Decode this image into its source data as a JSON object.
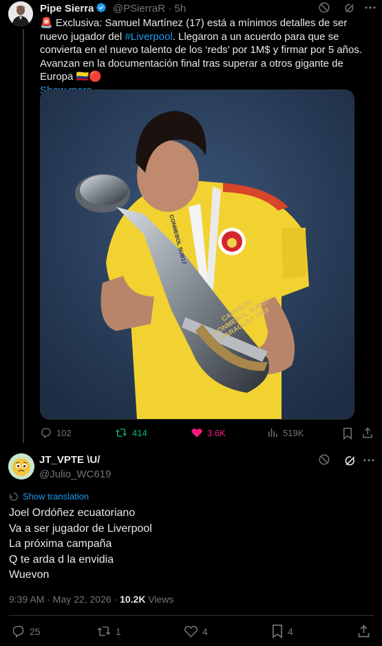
{
  "tweet": {
    "author_name": "Pipe Sierra",
    "handle": "@PSierraR",
    "time": "5h",
    "text_lead": "🚨 Exclusiva: Samuel Martínez (17) está a mínimos detalles de ser nuevo jugador del ",
    "hashtag": "#Liverpool",
    "text_tail": ". Llegaron a un acuerdo para que se convierta en el nuevo talento de los ‘reds’ por 1M$ y firmar por 5 años. Avanzan en la documentación final tras superar a otros gigante de Europa 🇨🇴🔴",
    "show_more": "Show more",
    "media_text": {
      "trophy_line1": "CAMPEÓN",
      "trophy_line2": "CONMEBOL SUB17",
      "trophy_line3": "PARAGUAY 2026",
      "lanyard": "CONMEBOL SUB17"
    },
    "stats": {
      "replies": "102",
      "reposts": "414",
      "likes": "3.6K",
      "views": "519K"
    }
  },
  "reply": {
    "author_name": "JT_VPTE \\U/",
    "handle": "@Julio_WC619",
    "show_translation": "Show translation",
    "lines": [
      "Joel Ordóñez ecuatoriano",
      "Va a ser jugador de Liverpool",
      "La próxima campaña",
      "Q te arda d la envidia",
      "Wuevon"
    ],
    "timestamp": "9:39 AM · May 22, 2026 · ",
    "view_count": "10.2K",
    "views_label": "Views",
    "stats": {
      "replies": "25",
      "reposts": "1",
      "likes": "4",
      "bookmarks": "4"
    }
  },
  "colors": {
    "link": "#1d9bf0",
    "repost": "#00ba7c",
    "like": "#f91880",
    "muted": "#71767b"
  }
}
